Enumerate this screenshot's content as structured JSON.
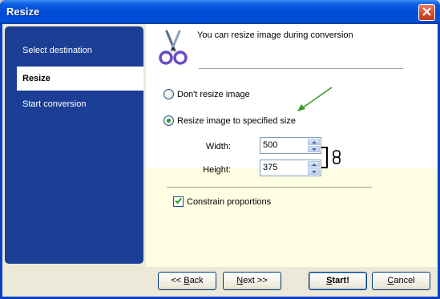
{
  "window": {
    "title": "Resize"
  },
  "nav": {
    "items": [
      {
        "label": "Select destination",
        "active": false
      },
      {
        "label": "Resize",
        "active": true
      },
      {
        "label": "Start conversion",
        "active": false
      }
    ]
  },
  "header": {
    "text": "You can resize image during conversion",
    "icon": "scissors-icon"
  },
  "options": {
    "dont_resize": {
      "label": "Don't resize image",
      "checked": false
    },
    "resize_to_size": {
      "label": "Resize image to specified size",
      "checked": true
    }
  },
  "size": {
    "width_label": "Width:",
    "width_value": "500",
    "height_label": "Height:",
    "height_value": "375"
  },
  "constrain": {
    "label": "Constrain proportions",
    "checked": true
  },
  "buttons": {
    "back_pre": "<< ",
    "back_u": "B",
    "back_post": "ack",
    "next_u": "N",
    "next_post": "ext >>",
    "start_u": "S",
    "start_post": "tart!",
    "cancel_u": "C",
    "cancel_post": "ancel"
  },
  "colors": {
    "title_bar": "#0049d6",
    "nav_panel": "#1c3f95",
    "content_lower": "#fefee2",
    "annotation_arrow": "#3a9a22"
  }
}
